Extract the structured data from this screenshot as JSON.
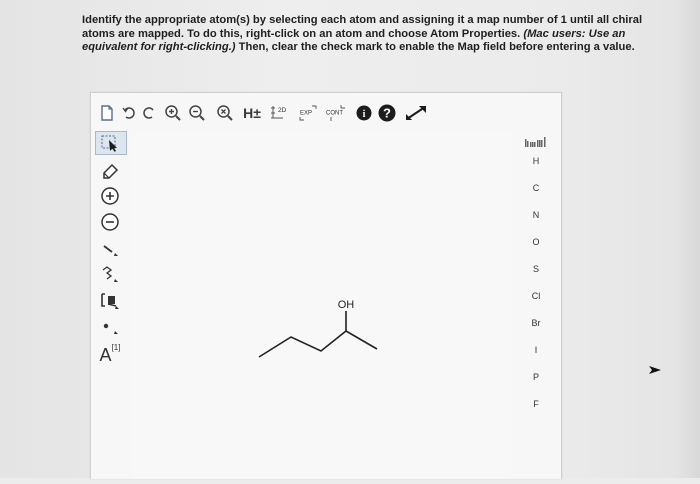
{
  "instructions": {
    "part1": "Identify the appropriate atom(s) by selecting each atom and assigning it a map number of 1 until all chiral atoms are mapped. To do this, right-click on an atom and choose Atom Properties. ",
    "part2": "(Mac users: Use an equivalent for right-clicking.)",
    "part3": " Then, clear the check mark to enable the Map field before entering a value."
  },
  "toolbar": {
    "h_plus": "H±",
    "two_d": "2D",
    "exp": "EXP",
    "cont": "CONT",
    "info": "i",
    "help": "?"
  },
  "left_tools": {
    "atom_map_label": "A",
    "atom_map_sup": "[1]"
  },
  "molecule": {
    "oh_label": "OH"
  },
  "elements": [
    "H",
    "C",
    "N",
    "O",
    "S",
    "Cl",
    "Br",
    "I",
    "P",
    "F"
  ]
}
